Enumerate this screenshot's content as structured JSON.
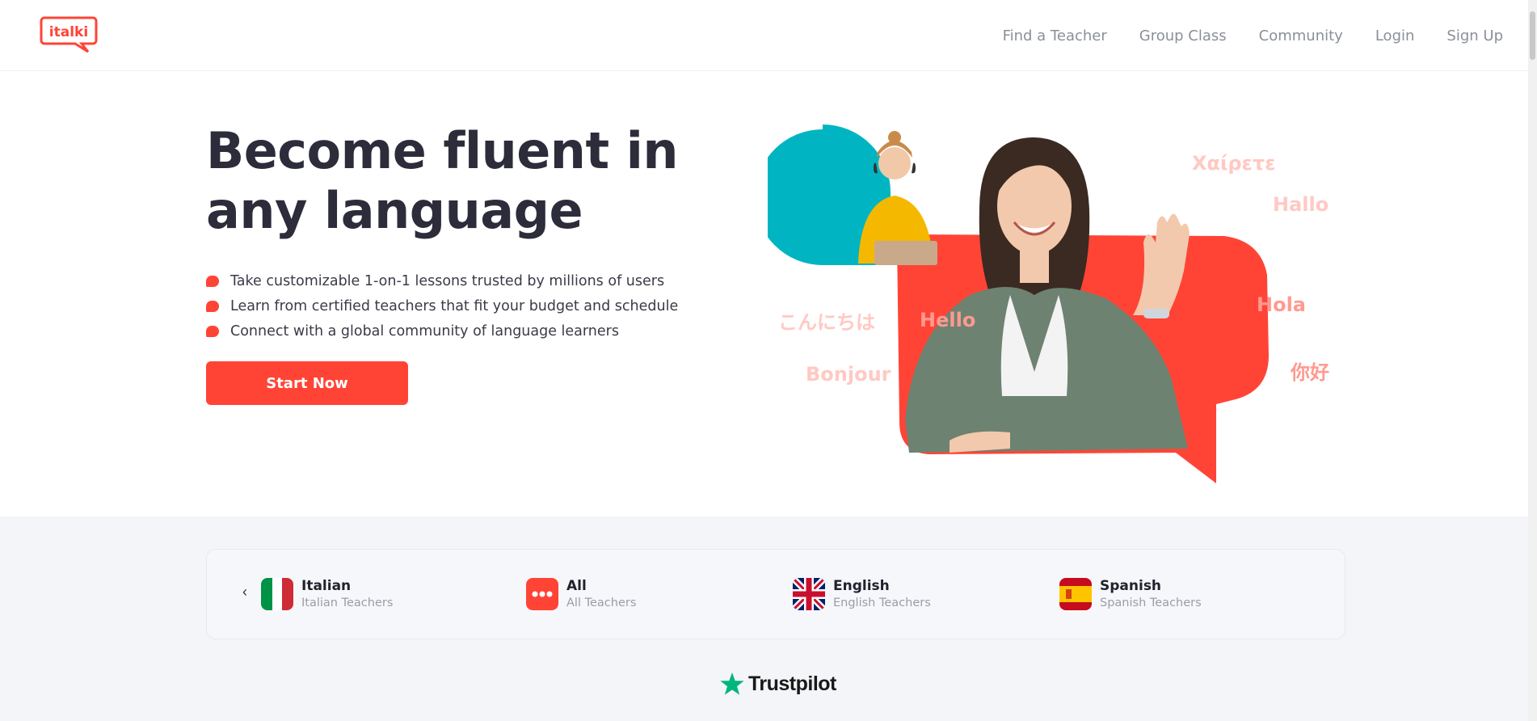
{
  "header": {
    "logo_text": "italki",
    "nav": [
      "Find a Teacher",
      "Group Class",
      "Community",
      "Login",
      "Sign Up"
    ]
  },
  "hero": {
    "title": "Become fluent in any language",
    "bullets": [
      "Take customizable 1-on-1 lessons trusted by millions of users",
      "Learn from certified teachers that fit your budget and schedule",
      "Connect with a global community of language learners"
    ],
    "cta_label": "Start Now",
    "greetings": {
      "greek": "Χαίρετε",
      "german": "Hallo",
      "japanese": "こんにちは",
      "english": "Hello",
      "spanish": "Hola",
      "french": "Bonjour",
      "chinese": "你好"
    }
  },
  "languages": [
    {
      "name": "Italian",
      "sub": "Italian Teachers"
    },
    {
      "name": "All",
      "sub": "All Teachers"
    },
    {
      "name": "English",
      "sub": "English Teachers"
    },
    {
      "name": "Spanish",
      "sub": "Spanish Teachers"
    }
  ],
  "footer": {
    "trustpilot_label": "Trustpilot"
  },
  "colors": {
    "brand": "#ff4436",
    "teal": "#00b5c1",
    "text_dark": "#2c2c3a"
  }
}
